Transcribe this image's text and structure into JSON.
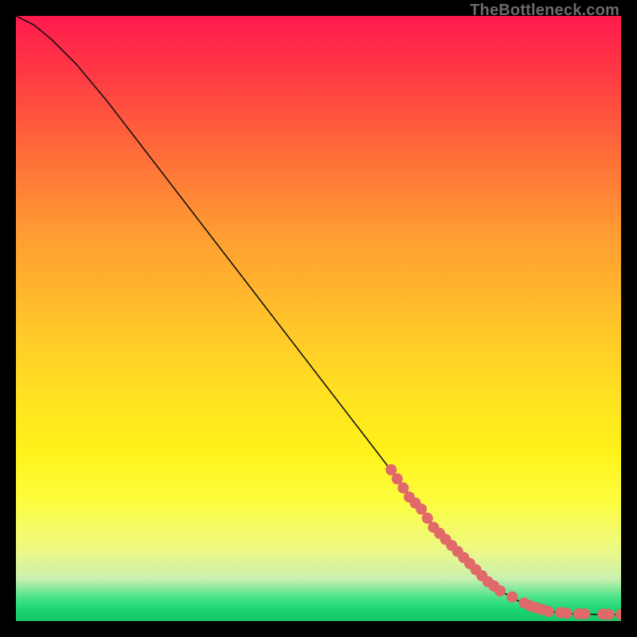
{
  "watermark": "TheBottleneck.com",
  "colors": {
    "curve": "#111111",
    "marker_fill": "#e06969",
    "marker_stroke": "#c95656"
  },
  "chart_data": {
    "type": "line",
    "title": "",
    "xlabel": "",
    "ylabel": "",
    "xlim": [
      0,
      100
    ],
    "ylim": [
      0,
      100
    ],
    "grid": false,
    "series": [
      {
        "name": "bottleneck-curve",
        "x": [
          0,
          3,
          6,
          10,
          15,
          20,
          30,
          40,
          50,
          60,
          68,
          74,
          80,
          84,
          88,
          92,
          96,
          100
        ],
        "y": [
          100,
          98.5,
          96,
          92,
          86,
          79.5,
          66.5,
          53.5,
          40.5,
          27.5,
          17,
          10.5,
          5,
          2.8,
          1.6,
          1.2,
          1.1,
          1.1
        ]
      }
    ],
    "markers": {
      "name": "highlight-points",
      "x": [
        62,
        63,
        64,
        65,
        66,
        67,
        68,
        69,
        70,
        71,
        72,
        73,
        74,
        75,
        76,
        77,
        78,
        79,
        80,
        82,
        84,
        85,
        86,
        87,
        88,
        90,
        91,
        93,
        94,
        97,
        98,
        100
      ],
      "y": [
        25,
        23.5,
        22,
        20.5,
        19.5,
        18.5,
        17,
        15.5,
        14.5,
        13.5,
        12.5,
        11.5,
        10.5,
        9.5,
        8.5,
        7.5,
        6.5,
        5.8,
        5,
        4,
        3,
        2.5,
        2.2,
        1.9,
        1.6,
        1.4,
        1.3,
        1.2,
        1.2,
        1.15,
        1.1,
        1.1
      ],
      "radius": 7
    }
  }
}
